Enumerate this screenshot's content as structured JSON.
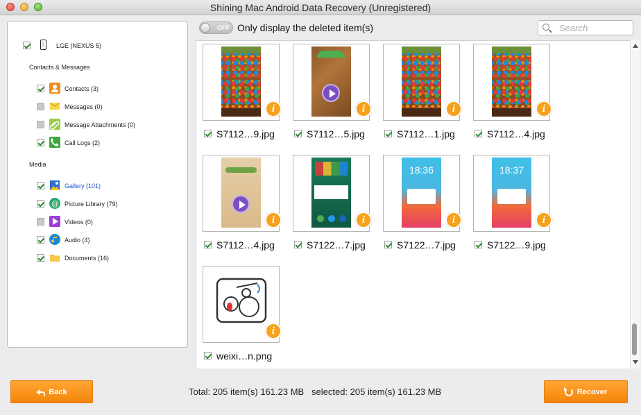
{
  "window": {
    "title": "Shining Mac Android Data Recovery (Unregistered)"
  },
  "sidebar": {
    "device": {
      "label": "LGE (NEXUS 5)",
      "checked": true
    },
    "sections": [
      {
        "title": "Contacts & Messages",
        "items": [
          {
            "label": "Contacts (3)",
            "checked": true,
            "icon": "contacts-icon",
            "color": "#f08c1e"
          },
          {
            "label": "Messages (0)",
            "checked": false,
            "icon": "messages-icon",
            "color": "#f2c21a"
          },
          {
            "label": "Message Attachments (0)",
            "checked": false,
            "icon": "attachment-icon",
            "color": "#8bc34a"
          },
          {
            "label": "Call Logs (2)",
            "checked": true,
            "icon": "phone-icon",
            "color": "#3ba93b"
          }
        ]
      },
      {
        "title": "Media",
        "items": [
          {
            "label": "Gallery (101)",
            "checked": true,
            "selected": true,
            "icon": "gallery-icon",
            "color": "#2f6fd6"
          },
          {
            "label": "Picture Library (79)",
            "checked": true,
            "icon": "picture-library-icon",
            "color": "#2aa36a"
          },
          {
            "label": "Videos (0)",
            "checked": false,
            "icon": "videos-icon",
            "color": "#9b3fd6"
          },
          {
            "label": "Audio (4)",
            "checked": true,
            "icon": "audio-icon",
            "color": "#1a8ad6"
          },
          {
            "label": "Documents (16)",
            "checked": true,
            "icon": "documents-icon",
            "color": "#f0b51e"
          }
        ]
      }
    ]
  },
  "toolbar": {
    "toggle_state": "OFF",
    "only_deleted_label": "Only display the deleted item(s)",
    "search_placeholder": "Search"
  },
  "files": [
    {
      "name": "S7112…9.jpg",
      "thumb": "candy"
    },
    {
      "name": "S7112…5.jpg",
      "thumb": "wood"
    },
    {
      "name": "S7112…1.jpg",
      "thumb": "candy"
    },
    {
      "name": "S7112…4.jpg",
      "thumb": "candy"
    },
    {
      "name": "S7112…4.jpg",
      "thumb": "beige"
    },
    {
      "name": "S7122…7.jpg",
      "thumb": "android-home"
    },
    {
      "name": "S7122…7.jpg",
      "thumb": "lock",
      "time": "18:36"
    },
    {
      "name": "S7122…9.jpg",
      "thumb": "lock",
      "time": "18:37"
    },
    {
      "name": "weixi…n.png",
      "thumb": "cartoon"
    }
  ],
  "footer": {
    "back_label": "Back",
    "recover_label": "Recover",
    "status_text": "Total: 205 item(s) 161.23 MB   selected: 205 item(s) 161.23 MB"
  },
  "colors": {
    "accent": "#f7941d",
    "selected_text": "#2356c9"
  }
}
